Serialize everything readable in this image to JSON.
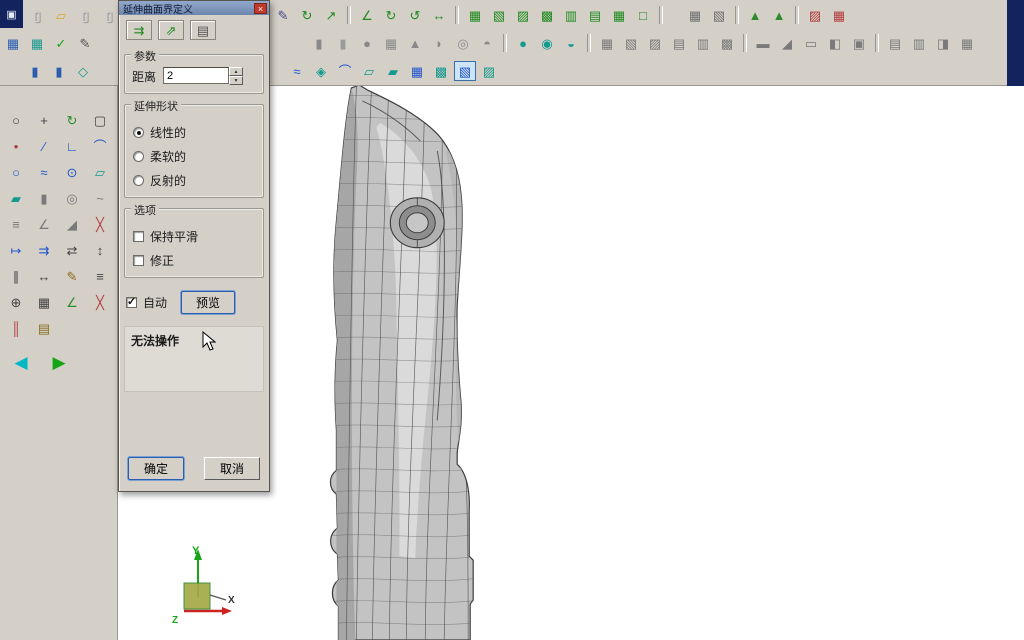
{
  "window": {
    "bg": "#d4d0c8",
    "navy": "#13235e"
  },
  "dialog": {
    "title": "延伸曲面界定义",
    "close_label": "×",
    "spin_up": "▲",
    "spin_down": "▼",
    "toolbar": [
      {
        "n": "copy-surface",
        "g": "⇉",
        "c": "#1e8a1e"
      },
      {
        "n": "export-surface",
        "g": "⇗",
        "c": "#1e8a1e"
      },
      {
        "n": "save-grid",
        "g": "▤",
        "c": "#555555"
      }
    ],
    "params_group": {
      "label": "参数",
      "distance_label": "距离",
      "distance_value": "2"
    },
    "shape_group": {
      "label": "延伸形状",
      "options": [
        {
          "label": "线性的",
          "selected": true
        },
        {
          "label": "柔软的",
          "selected": false
        },
        {
          "label": "反射的",
          "selected": false
        }
      ]
    },
    "options_group": {
      "label": "选项",
      "checks": [
        {
          "label": "保持平滑",
          "checked": false
        },
        {
          "label": "修正",
          "checked": false
        }
      ]
    },
    "auto_label": "自动",
    "auto_checked": true,
    "preview_label": "预览",
    "message": "无法操作",
    "ok_label": "确定",
    "cancel_label": "取消"
  },
  "toolbars": {
    "corner_glyph": "▣",
    "row1_left": [
      {
        "n": "new-file",
        "g": "▯",
        "c": "#ffffff",
        "sh": 1
      },
      {
        "n": "open-folder",
        "g": "▱",
        "c": "#d9a728"
      },
      {
        "n": "import-file",
        "g": "▯",
        "c": "#ffffff",
        "sh": 1
      },
      {
        "n": "export-file",
        "g": "▯",
        "c": "#ffffff",
        "sh": 1
      }
    ],
    "row1_right": [
      {
        "n": "edit-params",
        "g": "✎",
        "c": "#4a4a8a"
      },
      {
        "n": "rotate-object",
        "g": "↻",
        "c": "#1e8a1e"
      },
      {
        "n": "translate-axis",
        "g": "↗",
        "c": "#1e8a1e"
      },
      {
        "sep": 1
      },
      {
        "n": "axis-system",
        "g": "∠",
        "c": "#1e8a1e"
      },
      {
        "n": "rotate-cw",
        "g": "↻",
        "c": "#1e8a1e"
      },
      {
        "n": "rotate-ccw",
        "g": "↺",
        "c": "#1e8a1e"
      },
      {
        "n": "mirror-axis",
        "g": "↔",
        "c": "#1e8a1e"
      },
      {
        "sep": 1
      },
      {
        "n": "wire-cube-1",
        "g": "▦",
        "c": "#1e8a1e"
      },
      {
        "n": "wire-cube-2",
        "g": "▧",
        "c": "#1e8a1e"
      },
      {
        "n": "wire-cube-3",
        "g": "▨",
        "c": "#1e8a1e"
      },
      {
        "n": "wire-cube-4",
        "g": "▩",
        "c": "#1e8a1e"
      },
      {
        "n": "wire-cube-5",
        "g": "▥",
        "c": "#1e8a1e"
      },
      {
        "n": "wire-cube-6",
        "g": "▤",
        "c": "#1e8a1e"
      },
      {
        "n": "wire-cube-7",
        "g": "▦",
        "c": "#1e8a1e"
      },
      {
        "n": "wire-frame",
        "g": "□",
        "c": "#1e8a1e"
      },
      {
        "sep": 1
      },
      {
        "gap": 14
      },
      {
        "n": "gray-cube",
        "g": "▦",
        "c": "#6f6f6f"
      },
      {
        "n": "section-cube",
        "g": "▧",
        "c": "#6f6f6f"
      },
      {
        "sep": 1
      },
      {
        "n": "tree-view-1",
        "g": "▲",
        "c": "#2e8b2e"
      },
      {
        "n": "tree-view-2",
        "g": "▲",
        "c": "#2e8b2e"
      },
      {
        "sep": 1
      },
      {
        "n": "measure-red",
        "g": "▨",
        "c": "#b23b3b"
      },
      {
        "n": "chip-red",
        "g": "▦",
        "c": "#b23b3b"
      }
    ],
    "row2_left": [
      {
        "n": "blue-cube",
        "g": "▦",
        "c": "#2a5db0"
      },
      {
        "n": "teal-cube",
        "g": "▦",
        "c": "#159a8f"
      },
      {
        "n": "apply-check",
        "g": "✓",
        "c": "#18a418"
      },
      {
        "n": "edit-pencil",
        "g": "✎",
        "c": "#555555"
      }
    ],
    "row2_right": [
      {
        "n": "block-primitive",
        "g": "▮",
        "c": "#8a8a8a"
      },
      {
        "n": "cylinder-primitive",
        "g": "▮",
        "c": "#9a9a9a"
      },
      {
        "n": "sphere-primitive",
        "g": "●",
        "c": "#8a8a8a"
      },
      {
        "n": "cube-primitive",
        "g": "▦",
        "c": "#8a8a8a"
      },
      {
        "n": "cone-primitive",
        "g": "▲",
        "c": "#8a8a8a"
      },
      {
        "n": "oblate-primitive",
        "g": "◗",
        "c": "#8a8a8a"
      },
      {
        "n": "torus-primitive",
        "g": "◎",
        "c": "#8a8a8a"
      },
      {
        "n": "hemisphere-primitive",
        "g": "◓",
        "c": "#8a8a8a"
      },
      {
        "sep": 1
      },
      {
        "n": "teal-sphere",
        "g": "●",
        "c": "#159a8f"
      },
      {
        "n": "teal-ball",
        "g": "◉",
        "c": "#159a8f"
      },
      {
        "n": "teal-half",
        "g": "◒",
        "c": "#159a8f"
      },
      {
        "sep": 1
      },
      {
        "n": "solid-cube-1",
        "g": "▦",
        "c": "#7a7a7a"
      },
      {
        "n": "solid-cube-2",
        "g": "▧",
        "c": "#7a7a7a"
      },
      {
        "n": "solid-cube-3",
        "g": "▨",
        "c": "#7a7a7a"
      },
      {
        "n": "solid-cube-4",
        "g": "▤",
        "c": "#7a7a7a"
      },
      {
        "n": "solid-cube-5",
        "g": "▥",
        "c": "#7a7a7a"
      },
      {
        "n": "solid-cube-6",
        "g": "▩",
        "c": "#7a7a7a"
      },
      {
        "sep": 1
      },
      {
        "n": "slab",
        "g": "▬",
        "c": "#7a7a7a"
      },
      {
        "n": "wedge",
        "g": "◢",
        "c": "#7a7a7a"
      },
      {
        "n": "plate",
        "g": "▭",
        "c": "#7a7a7a"
      },
      {
        "n": "shell-cube",
        "g": "◧",
        "c": "#7a7a7a"
      },
      {
        "n": "round-cube",
        "g": "▣",
        "c": "#7a7a7a"
      },
      {
        "sep": 1
      },
      {
        "n": "fillet-cube",
        "g": "▤",
        "c": "#7a7a7a"
      },
      {
        "n": "chamfer-cube",
        "g": "▥",
        "c": "#7a7a7a"
      },
      {
        "n": "draft-cube",
        "g": "◨",
        "c": "#7a7a7a"
      },
      {
        "n": "thick-cube",
        "g": "▦",
        "c": "#7a7a7a"
      }
    ],
    "row3_left": [
      {
        "n": "blue-panel-1",
        "g": "▮",
        "c": "#2a5db0"
      },
      {
        "n": "blue-panel-2",
        "g": "▮",
        "c": "#2a5db0"
      },
      {
        "n": "teal-diamond",
        "g": "◇",
        "c": "#159a8f"
      }
    ],
    "row3_right": [
      {
        "n": "point-curve",
        "g": "≈",
        "c": "#2255cc"
      },
      {
        "n": "surface-diamond",
        "g": "◈",
        "c": "#159a8f"
      },
      {
        "n": "curve-tool",
        "g": "⌒",
        "c": "#2255cc"
      },
      {
        "n": "patch-surface",
        "g": "▱",
        "c": "#159a8f"
      },
      {
        "n": "blend-surface",
        "g": "▰",
        "c": "#159a8f"
      },
      {
        "n": "mesh-surface",
        "g": "▦",
        "c": "#2255cc"
      },
      {
        "n": "net-surface",
        "g": "▩",
        "c": "#159a8f"
      },
      {
        "n": "extend-surface",
        "g": "▧",
        "c": "#2255cc",
        "active": 1
      },
      {
        "n": "offset-surface",
        "g": "▨",
        "c": "#159a8f"
      }
    ]
  },
  "sidebar": {
    "icons": [
      {
        "n": "zoom",
        "g": "○",
        "c": "#444444"
      },
      {
        "n": "pan",
        "g": "+",
        "c": "#444444"
      },
      {
        "n": "rotate-view",
        "g": "↻",
        "c": "#2e8b2e"
      },
      {
        "n": "fit-view",
        "g": "▢",
        "c": "#444444"
      },
      {
        "n": "point-tool",
        "g": "•",
        "c": "#b23b3b"
      },
      {
        "n": "line-tool",
        "g": "∕",
        "c": "#2255cc"
      },
      {
        "n": "polyline-tool",
        "g": "∟",
        "c": "#2255cc"
      },
      {
        "n": "arc-tool",
        "g": "⌒",
        "c": "#2255cc"
      },
      {
        "n": "circle-tool",
        "g": "○",
        "c": "#2255cc"
      },
      {
        "n": "spline-tool",
        "g": "≈",
        "c": "#2255cc"
      },
      {
        "n": "ellipse-tool",
        "g": "⊙",
        "c": "#2255cc"
      },
      {
        "n": "plane-tool",
        "g": "▱",
        "c": "#159a8f"
      },
      {
        "n": "surface-tool",
        "g": "▰",
        "c": "#159a8f"
      },
      {
        "n": "extrude-tool",
        "g": "▮",
        "c": "#7a7a7a"
      },
      {
        "n": "revolve-tool",
        "g": "◎",
        "c": "#7a7a7a"
      },
      {
        "n": "sweep-tool",
        "g": "~",
        "c": "#7a7a7a"
      },
      {
        "n": "loft-tool",
        "g": "≡",
        "c": "#7a7a7a"
      },
      {
        "n": "fillet-tool",
        "g": "∠",
        "c": "#7a7a7a"
      },
      {
        "n": "chamfer-tool",
        "g": "◢",
        "c": "#7a7a7a"
      },
      {
        "n": "trim-tool",
        "g": "╳",
        "c": "#b23b3b"
      },
      {
        "n": "extend-tool",
        "g": "↦",
        "c": "#2255cc"
      },
      {
        "n": "offset-tool",
        "g": "⇉",
        "c": "#2255cc"
      },
      {
        "n": "mirror-tool",
        "g": "⇄",
        "c": "#444444"
      },
      {
        "n": "scale-tool",
        "g": "↕",
        "c": "#444444"
      },
      {
        "n": "measure-tool",
        "g": "∥",
        "c": "#444444"
      },
      {
        "n": "dimension-tool",
        "g": "↔",
        "c": "#444444"
      },
      {
        "n": "annotate-tool",
        "g": "✎",
        "c": "#8a6d1e"
      },
      {
        "n": "layers-tool",
        "g": "≡",
        "c": "#444444"
      },
      {
        "n": "snap-tool",
        "g": "⊕",
        "c": "#444444"
      },
      {
        "n": "grid-toggle",
        "g": "▦",
        "c": "#444444"
      },
      {
        "n": "axis-tool",
        "g": "∠",
        "c": "#2e8b2e"
      },
      {
        "n": "delete-tool",
        "g": "╳",
        "c": "#b23b3b"
      },
      {
        "n": "barcode-tool",
        "g": "║",
        "c": "#b23b3b"
      },
      {
        "n": "export-session",
        "g": "▤",
        "c": "#8a6d1e"
      }
    ],
    "nav": [
      {
        "n": "back-arrow",
        "g": "◀",
        "c": "#00b7c3"
      },
      {
        "n": "forward-arrow",
        "g": "▶",
        "c": "#18a418"
      }
    ]
  },
  "viewport": {
    "axes": {
      "x": "X",
      "y": "Y",
      "z": "Z"
    }
  }
}
